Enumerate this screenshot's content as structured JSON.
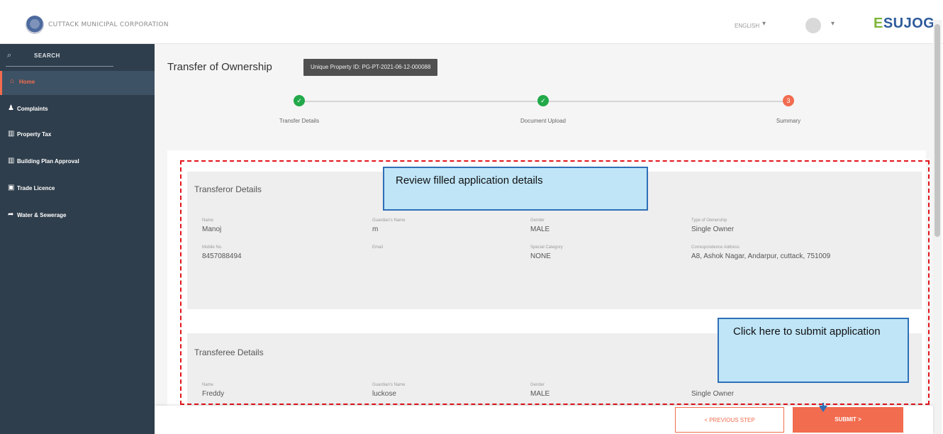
{
  "header": {
    "org_name": "CUTTACK MUNICIPAL CORPORATION",
    "language": "ENGLISH",
    "brand_prefix": "E",
    "brand_rest": "SUJOG"
  },
  "sidebar": {
    "search_label": "SEARCH",
    "items": [
      {
        "label": "Home",
        "icon": "home-icon",
        "active": true
      },
      {
        "label": "Complaints",
        "icon": "complaints-icon"
      },
      {
        "label": "Property Tax",
        "icon": "property-tax-icon"
      },
      {
        "label": "Building Plan Approval",
        "icon": "building-icon"
      },
      {
        "label": "Trade Licence",
        "icon": "trade-icon"
      },
      {
        "label": "Water & Sewerage",
        "icon": "water-icon"
      }
    ]
  },
  "main": {
    "title": "Transfer of Ownership",
    "property_id": "Unique Property ID: PG-PT-2021-06-12-000088"
  },
  "stepper": {
    "steps": [
      {
        "label": "Transfer Details",
        "state": "done"
      },
      {
        "label": "Document Upload",
        "state": "done"
      },
      {
        "label": "Summary",
        "state": "current",
        "number": "3"
      }
    ]
  },
  "transferor": {
    "title": "Transferor Details",
    "name_label": "Name",
    "name": "Manoj",
    "guardian_label": "Guardian's Name",
    "guardian": "m",
    "gender_label": "Gender",
    "gender": "MALE",
    "ownership_label": "Type of Ownership",
    "ownership": "Single Owner",
    "mobile_label": "Mobile No.",
    "mobile": "8457088494",
    "email_label": "Email",
    "email": "",
    "category_label": "Special Category",
    "category": "NONE",
    "address_label": "Correspondence Address",
    "address": "A8, Ashok Nagar, Andarpur, cuttack, 751009"
  },
  "transferee": {
    "title": "Transferee Details",
    "name_label": "Name",
    "name": "Freddy",
    "guardian_label": "Guardian's Name",
    "guardian": "luckose",
    "gender_label": "Gender",
    "gender": "MALE",
    "ownership": "Single Owner"
  },
  "callouts": {
    "review": "Review filled application details",
    "submit": "Click here to submit application"
  },
  "buttons": {
    "prev": "< PREVIOUS STEP",
    "submit": "SUBMIT >"
  },
  "colors": {
    "accent": "#f26c4f",
    "sidebar": "#2f3e4c",
    "success": "#22a94a",
    "callout_bg": "#bfe5f7",
    "callout_border": "#2f6fb7",
    "annotation": "#e3141b"
  }
}
